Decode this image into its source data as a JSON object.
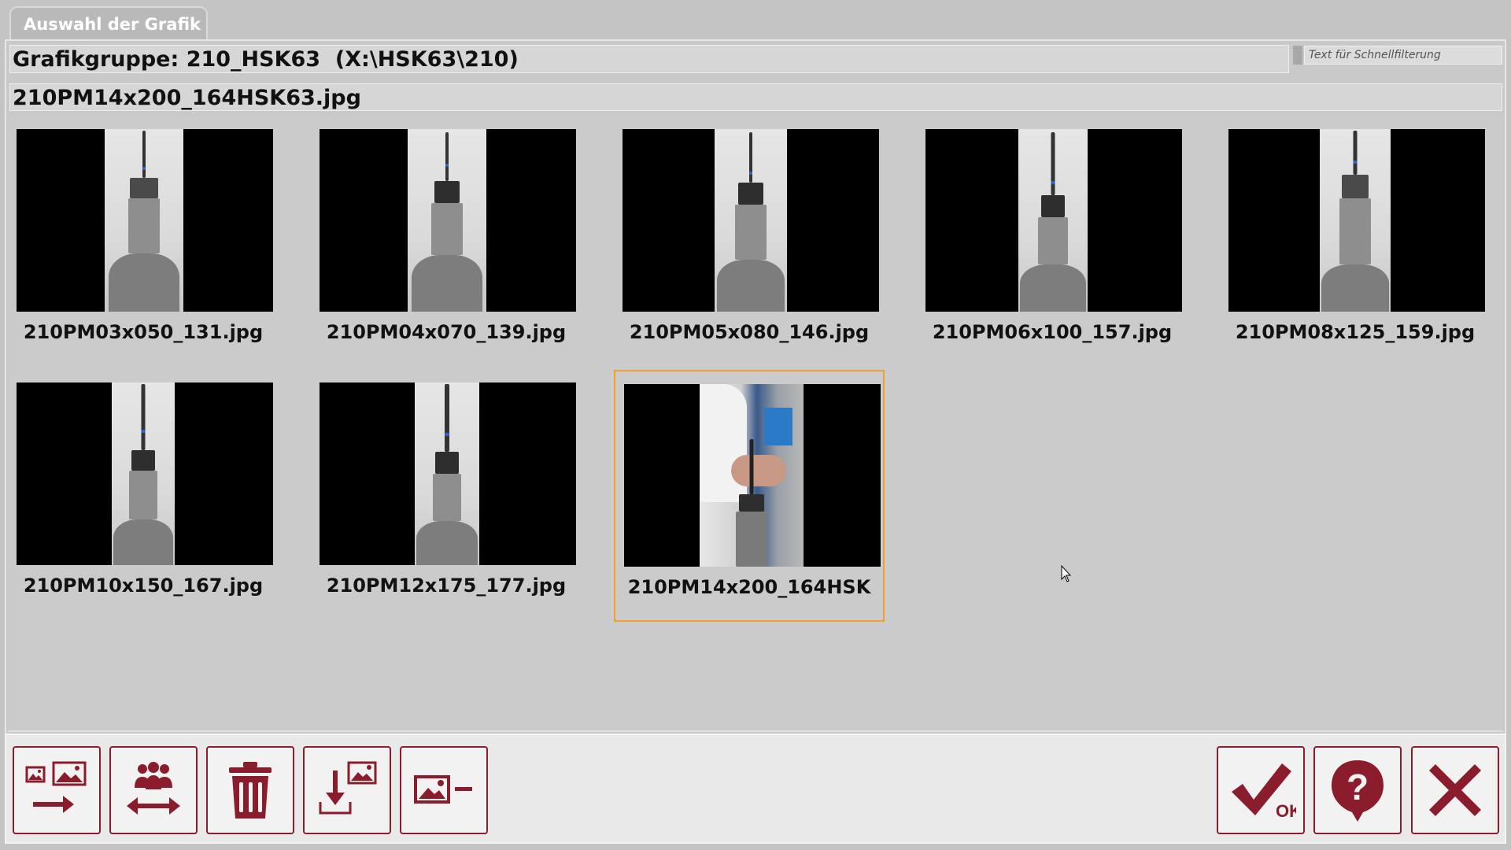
{
  "window": {
    "tab_title": "Auswahl der Grafik"
  },
  "group_bar": {
    "text": "Grafikgruppe: 210_HSK63  (X:\\HSK63\\210)"
  },
  "filter": {
    "placeholder": "Text für Schnellfilterung"
  },
  "selected_file": "210PM14x200_164HSK63.jpg",
  "gallery": {
    "items": [
      {
        "caption": "210PM03x050_131.jpg"
      },
      {
        "caption": "210PM04x070_139.jpg"
      },
      {
        "caption": "210PM05x080_146.jpg"
      },
      {
        "caption": "210PM06x100_157.jpg"
      },
      {
        "caption": "210PM08x125_159.jpg"
      },
      {
        "caption": "210PM10x150_167.jpg"
      },
      {
        "caption": "210PM12x175_177.jpg"
      },
      {
        "caption": "210PM14x200_164HSK",
        "selected": true
      }
    ]
  },
  "toolbar": {
    "left_buttons": [
      {
        "icon": "import-images-icon"
      },
      {
        "icon": "swap-group-icon"
      },
      {
        "icon": "trash-icon"
      },
      {
        "icon": "download-image-icon"
      },
      {
        "icon": "remove-image-icon"
      }
    ],
    "ok_label": "OK",
    "help_label": "?",
    "accent_color": "#8a1c2c",
    "selection_color": "#f0a032"
  }
}
